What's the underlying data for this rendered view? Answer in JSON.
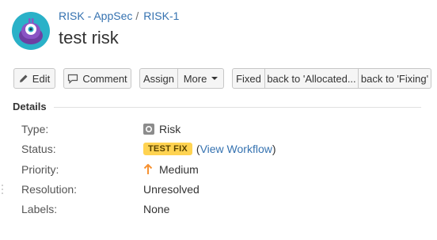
{
  "header": {
    "project": "RISK - AppSec",
    "separator": "/",
    "issue_key": "RISK-1",
    "title": "test risk"
  },
  "toolbar": {
    "edit": "Edit",
    "comment": "Comment",
    "assign": "Assign",
    "more": "More",
    "fixed": "Fixed",
    "back_to_allocated": "back to 'Allocated...",
    "back_to_fixing": "back to 'Fixing'"
  },
  "details": {
    "heading": "Details",
    "type_label": "Type:",
    "type_value": "Risk",
    "status_label": "Status:",
    "status_value": "TEST FIX",
    "status_open_paren": "(",
    "view_workflow": "View Workflow",
    "status_close_paren": ")",
    "priority_label": "Priority:",
    "priority_value": "Medium",
    "resolution_label": "Resolution:",
    "resolution_value": "Unresolved",
    "labels_label": "Labels:",
    "labels_value": "None"
  },
  "colors": {
    "link": "#3572b0",
    "status_lozenge": "#ffd351",
    "priority_medium": "#f79232",
    "avatar_bg": "#2ab1c8",
    "avatar_monster": "#6e3fa3"
  },
  "icons": {
    "avatar": "project-avatar-monster",
    "edit": "pencil-icon",
    "comment": "speech-bubble-icon",
    "more": "chevron-down-icon",
    "type": "risk-type-icon",
    "priority": "arrow-up-icon"
  }
}
